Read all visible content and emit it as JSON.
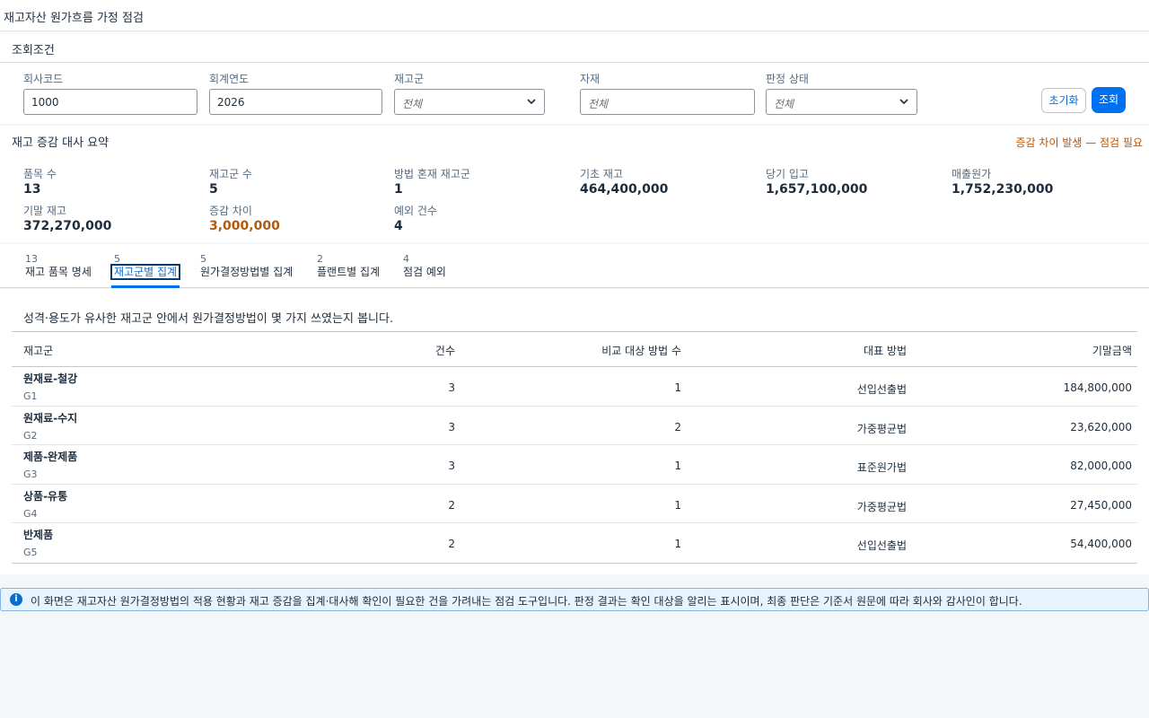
{
  "app": {
    "title": "재고자산 원가흐름 가정 점검"
  },
  "filters": {
    "title": "조회조건",
    "company_code": {
      "label": "회사코드",
      "value": "1000"
    },
    "fiscal_year": {
      "label": "회계연도",
      "value": "2026"
    },
    "inventory_group": {
      "label": "재고군",
      "value": "전체"
    },
    "material": {
      "label": "자재",
      "placeholder": "전체"
    },
    "judgement_status": {
      "label": "판정 상태",
      "value": "전체"
    },
    "reset_label": "초기화",
    "search_label": "조회"
  },
  "summary": {
    "title": "재고 증감 대사 요약",
    "warning": "증감 차이 발생 — 점검 필요",
    "kpis": [
      {
        "label": "품목 수",
        "value": "13"
      },
      {
        "label": "재고군 수",
        "value": "5"
      },
      {
        "label": "방법 혼재 재고군",
        "value": "1"
      },
      {
        "label": "기초 재고",
        "value": "464,400,000"
      },
      {
        "label": "당기 입고",
        "value": "1,657,100,000"
      },
      {
        "label": "매출원가",
        "value": "1,752,230,000"
      },
      {
        "label": "기말 재고",
        "value": "372,270,000"
      },
      {
        "label": "증감 차이",
        "value": "3,000,000"
      },
      {
        "label": "예외 건수",
        "value": "4"
      }
    ]
  },
  "tabs": [
    {
      "count": "13",
      "label": "재고 품목 명세"
    },
    {
      "count": "5",
      "label": "재고군별 집계"
    },
    {
      "count": "5",
      "label": "원가결정방법별 집계"
    },
    {
      "count": "2",
      "label": "플랜트별 집계"
    },
    {
      "count": "4",
      "label": "점검 예외"
    }
  ],
  "content": {
    "hint": "성격·용도가 유사한 재고군 안에서 원가결정방법이 몇 가지 쓰였는지 봅니다.",
    "columns": [
      "재고군",
      "건수",
      "비교 대상 방법 수",
      "대표 방법",
      "기말금액"
    ],
    "rows": [
      {
        "name": "원재료-철강",
        "code": "G1",
        "count": "3",
        "methods": "1",
        "method": "선입선출법",
        "amount": "184,800,000"
      },
      {
        "name": "원재료-수지",
        "code": "G2",
        "count": "3",
        "methods": "2",
        "method": "가중평균법",
        "amount": "23,620,000"
      },
      {
        "name": "제품-완제품",
        "code": "G3",
        "count": "3",
        "methods": "1",
        "method": "표준원가법",
        "amount": "82,000,000"
      },
      {
        "name": "상품-유통",
        "code": "G4",
        "count": "2",
        "methods": "1",
        "method": "가중평균법",
        "amount": "27,450,000"
      },
      {
        "name": "반제품",
        "code": "G5",
        "count": "2",
        "methods": "1",
        "method": "선입선출법",
        "amount": "54,400,000"
      }
    ]
  },
  "info": {
    "icon": "i",
    "text": "이 화면은 재고자산 원가결정방법의 적용 현황과 재고 증감을 집계·대사해 확인이 필요한 건을 가려내는 점검 도구입니다. 판정 결과는 확인 대상을 알리는 표시이며, 최종 판단은 기준서 원문에 따라 회사와 감사인이 합니다."
  }
}
